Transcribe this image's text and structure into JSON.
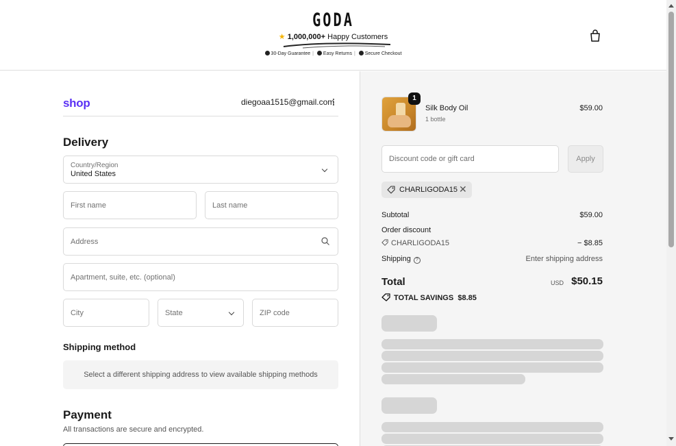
{
  "header": {
    "logo": "GODA",
    "happy_count": "1,000,000+",
    "happy_text": "Happy Customers",
    "badges": [
      "30-Day Guarantee",
      "Easy Returns",
      "Secure Checkout"
    ]
  },
  "account": {
    "provider": "shop",
    "email": "diegoaa1515@gmail.com"
  },
  "delivery": {
    "title": "Delivery",
    "country_label": "Country/Region",
    "country_value": "United States",
    "first_name_placeholder": "First name",
    "last_name_placeholder": "Last name",
    "address_placeholder": "Address",
    "apartment_placeholder": "Apartment, suite, etc. (optional)",
    "city_placeholder": "City",
    "state_placeholder": "State",
    "zip_placeholder": "ZIP code"
  },
  "shipping_method": {
    "title": "Shipping method",
    "message": "Select a different shipping address to view available shipping methods"
  },
  "payment": {
    "title": "Payment",
    "subtitle": "All transactions are secure and encrypted."
  },
  "summary": {
    "product": {
      "name": "Silk Body Oil",
      "variant": "1 bottle",
      "price": "$59.00",
      "quantity": "1"
    },
    "discount_placeholder": "Discount code or gift card",
    "apply_label": "Apply",
    "applied_code": "CHARLIGODA15",
    "subtotal_label": "Subtotal",
    "subtotal_value": "$59.00",
    "order_discount_label": "Order discount",
    "discount_code": "CHARLIGODA15",
    "discount_value": "− $8.85",
    "shipping_label": "Shipping",
    "shipping_value": "Enter shipping address",
    "total_label": "Total",
    "currency": "USD",
    "total_value": "$50.15",
    "savings_label": "TOTAL SAVINGS",
    "savings_value": "$8.85"
  },
  "colors": {
    "shop_brand": "#5a31f4",
    "skeleton": "#d6d6d6",
    "summary_bg": "#f5f5f5"
  }
}
